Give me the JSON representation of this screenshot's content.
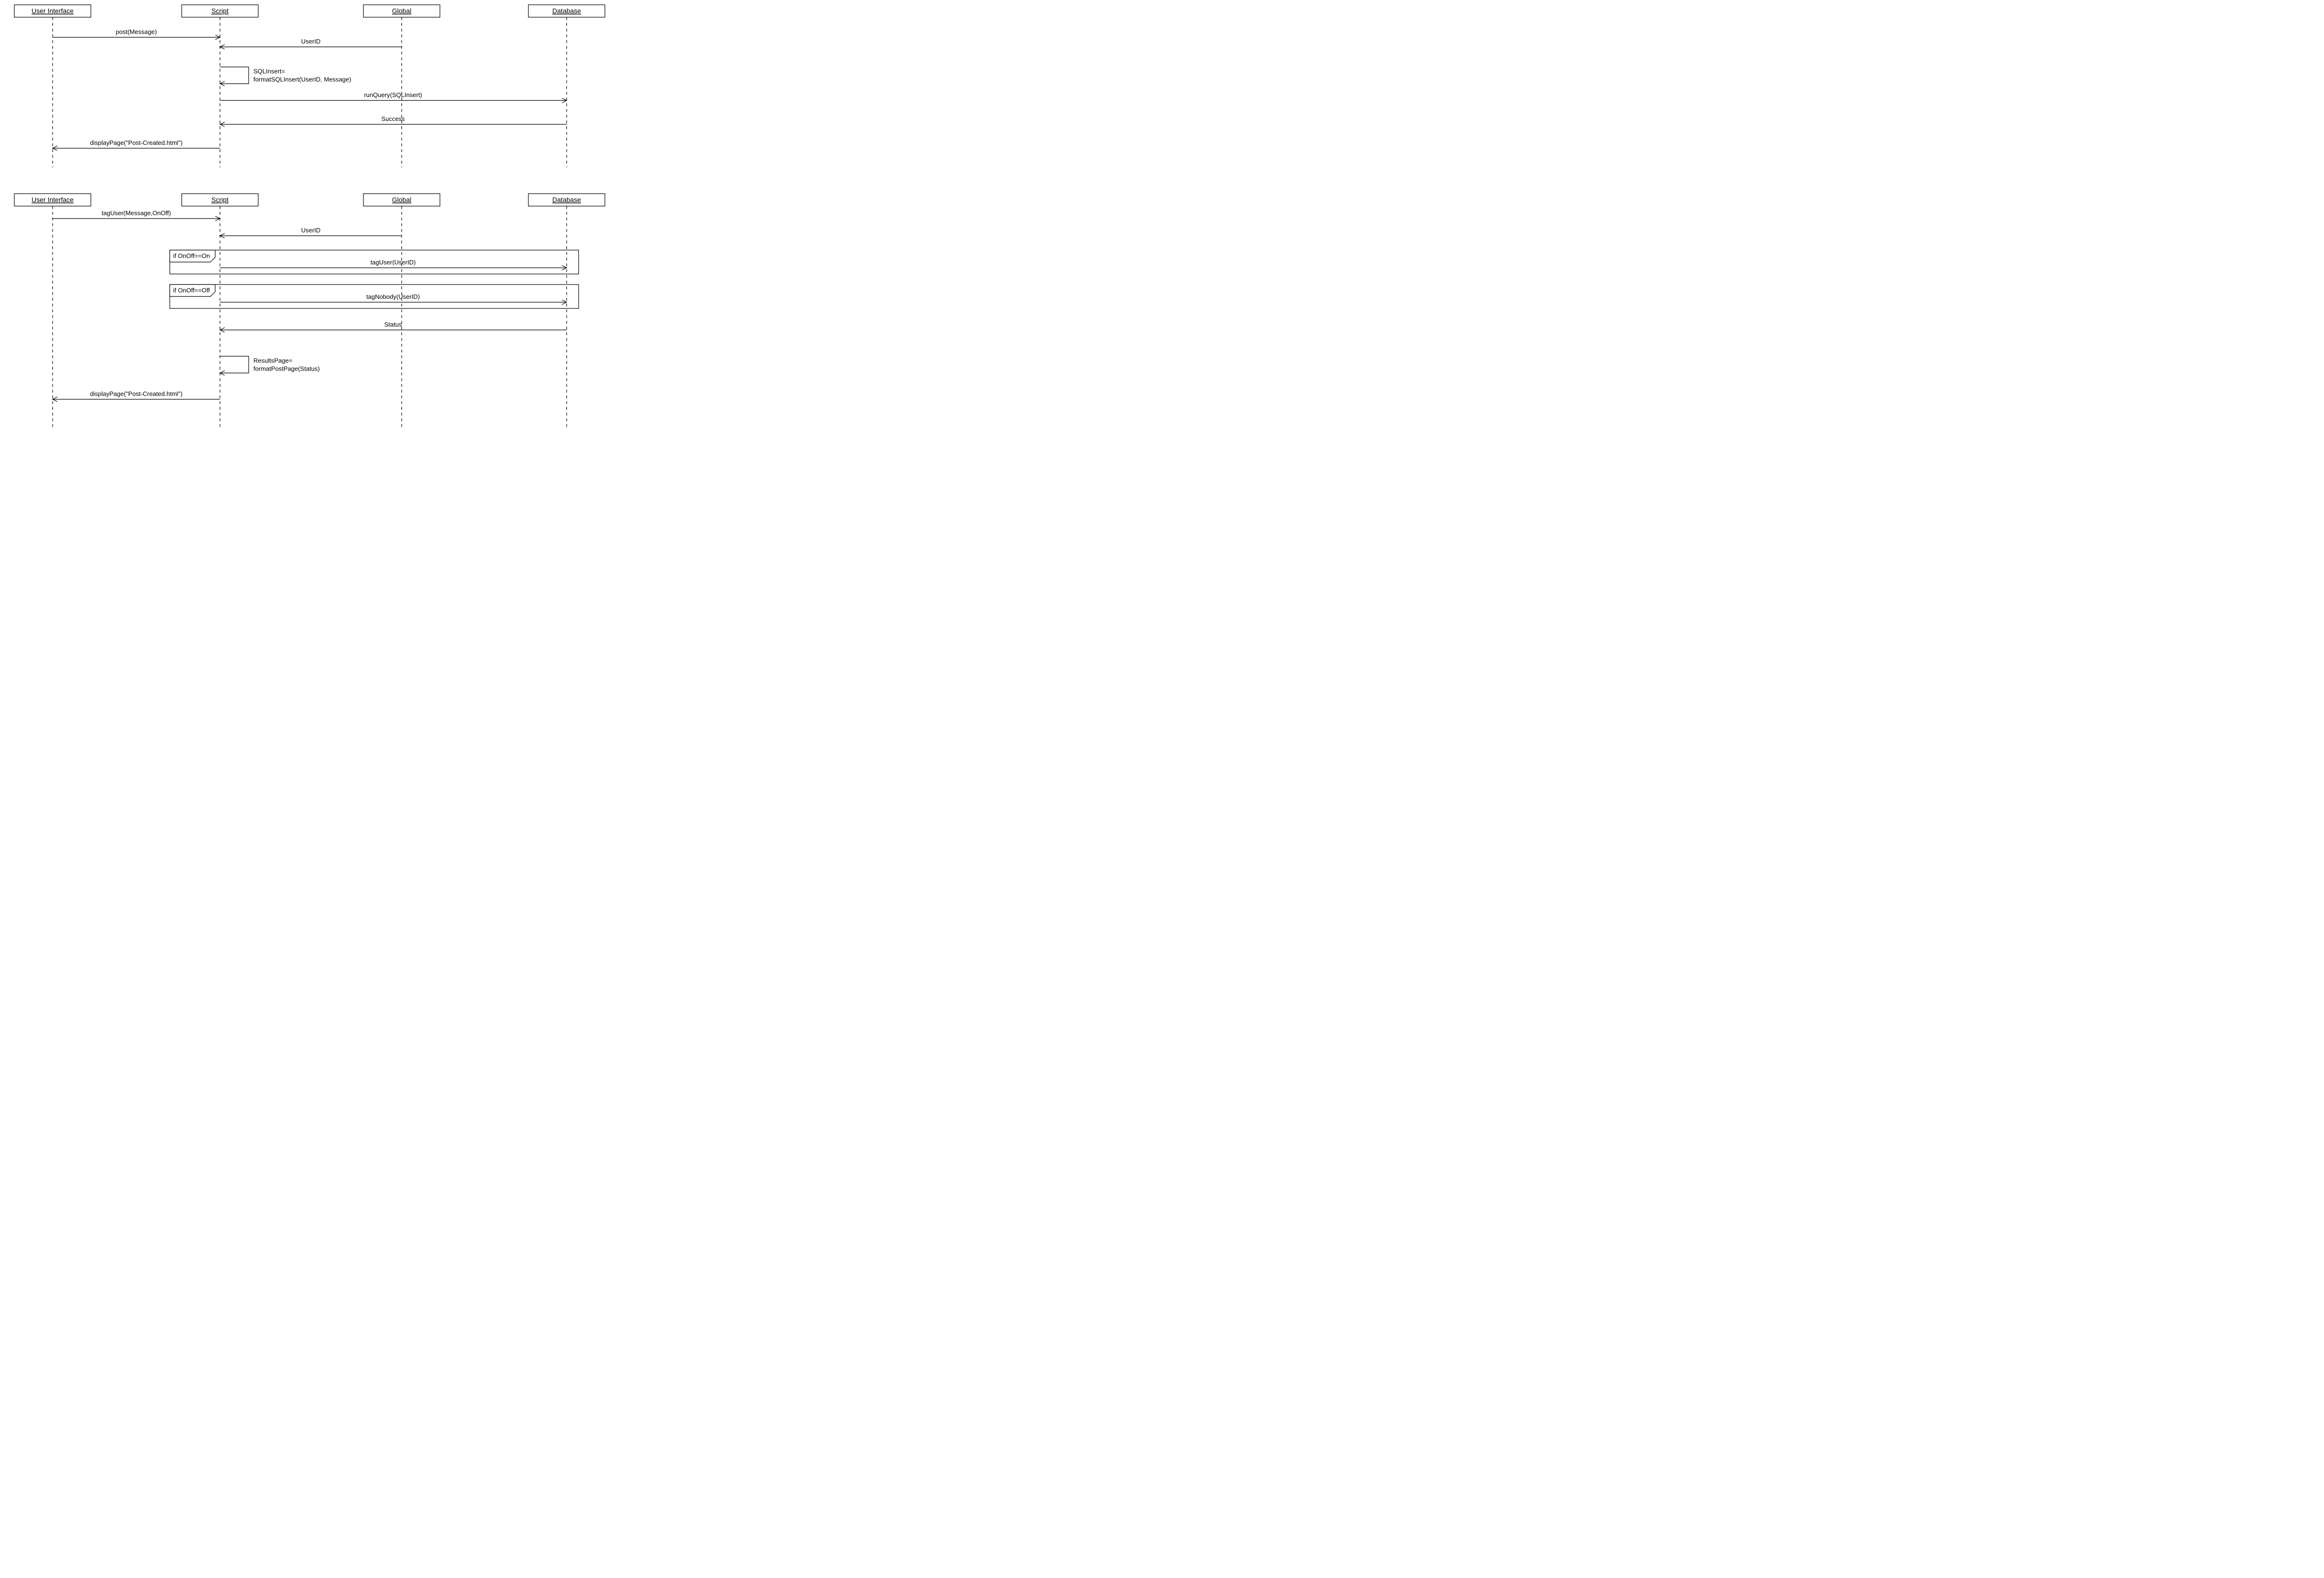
{
  "diagram1": {
    "lifelines": {
      "ui": "User Interface",
      "script": "Script",
      "global": "Global",
      "db": "Database"
    },
    "messages": {
      "m1": "post(Message)",
      "m2": "UserID",
      "m3a": "SQLInsert=",
      "m3b": "formatSQLInsert(UserID, Message)",
      "m4": "runQuery(SQLInsert)",
      "m5": "Success",
      "m6": "displayPage(\"Post-Created.html\")"
    }
  },
  "diagram2": {
    "lifelines": {
      "ui": "User Interface",
      "script": "Script",
      "global": "Global",
      "db": "Database"
    },
    "messages": {
      "m1": "tagUser(Message,OnOff)",
      "frame1_guard": "if OnOff==On",
      "m2": "UserID",
      "m3": "tagUser(UserID)",
      "frame2_guard": "if OnOff==Off",
      "m4": "tagNobody(UserID)",
      "m5": "Status",
      "m6a": "ResultsPage=",
      "m6b": "formatPostPage(Status)",
      "m7": "displayPage(\"Post-Created.html\")"
    }
  }
}
